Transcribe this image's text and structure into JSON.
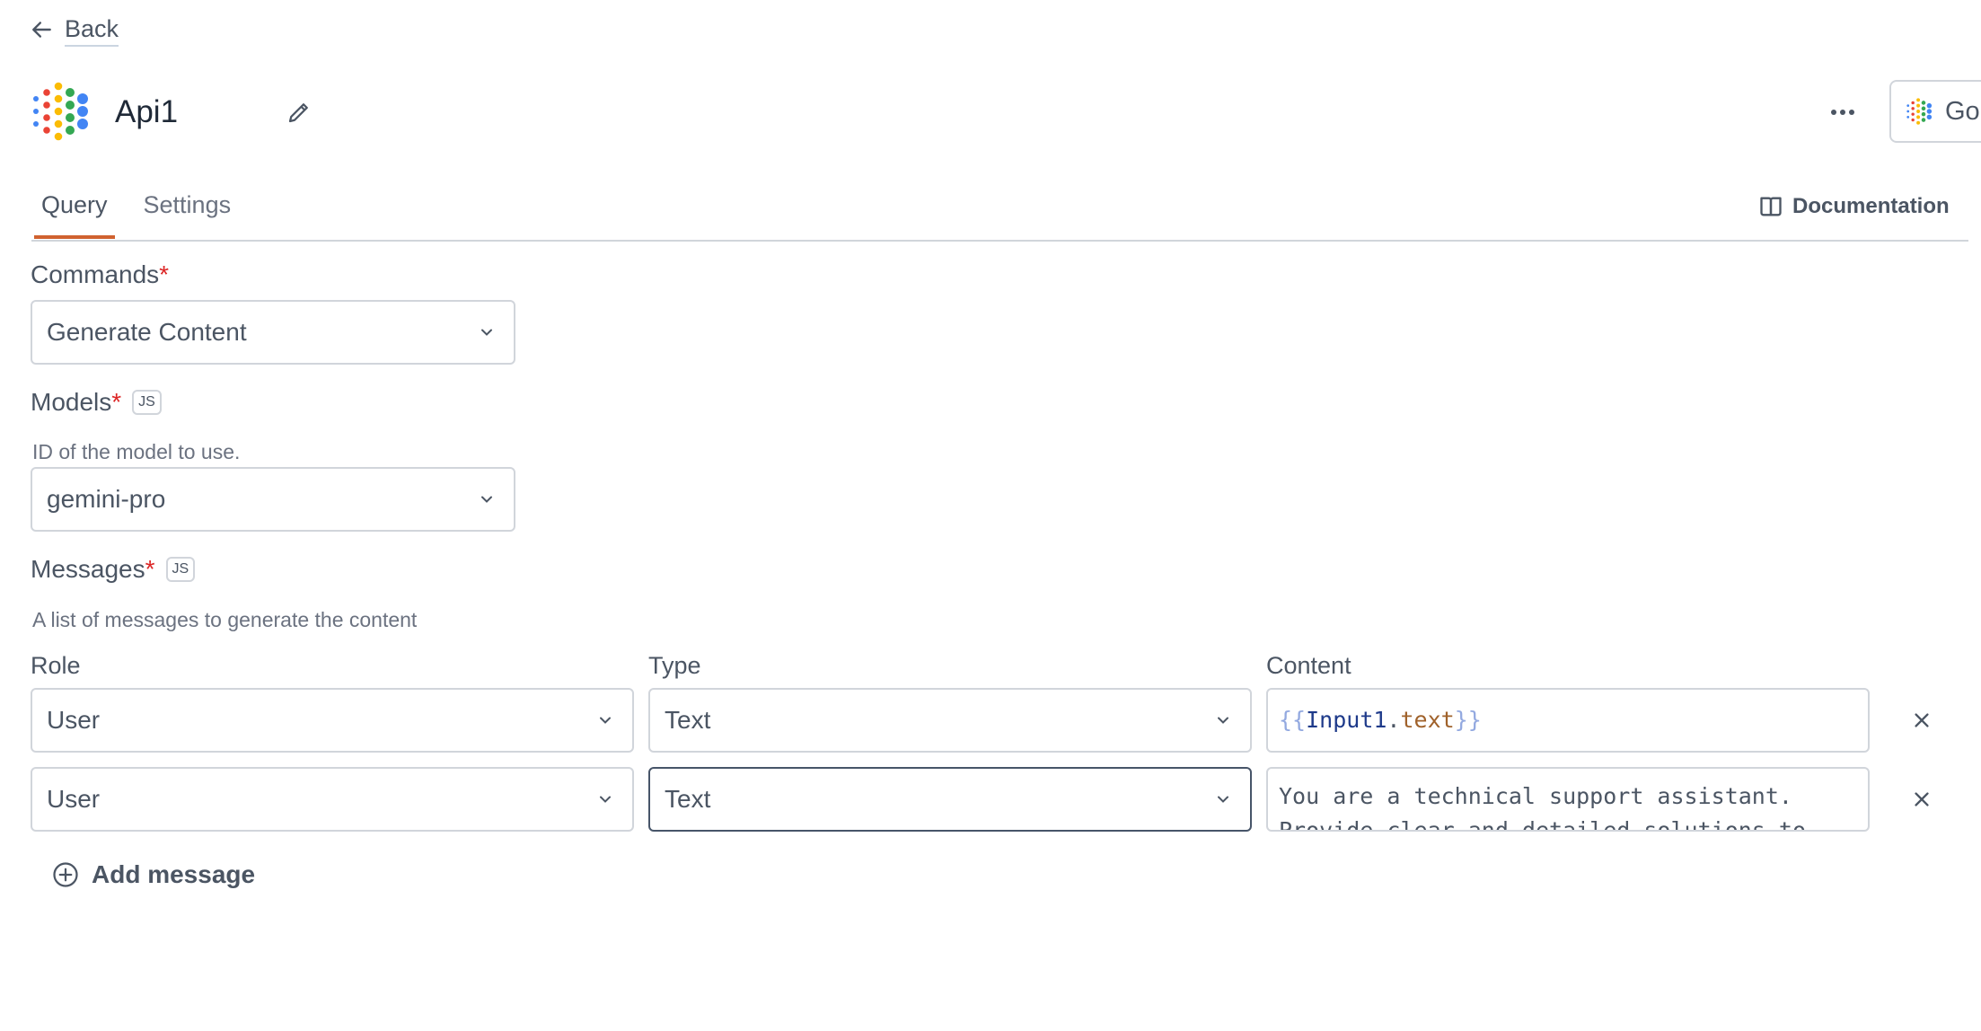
{
  "nav": {
    "back_label": "Back",
    "back_icon": "arrow-left-icon"
  },
  "header": {
    "title": "Api1",
    "logo_icon": "gemini-dots-logo",
    "edit_icon": "pencil-icon",
    "more_icon": "ellipsis-icon",
    "datasource_button_label": "Go"
  },
  "tabs": [
    {
      "label": "Query",
      "active": true
    },
    {
      "label": "Settings",
      "active": false
    }
  ],
  "documentation": {
    "label": "Documentation",
    "icon": "book-open-icon"
  },
  "form": {
    "commands": {
      "label": "Commands",
      "required": "*",
      "value": "Generate Content"
    },
    "models": {
      "label": "Models",
      "required": "*",
      "badge": "JS",
      "helper": "ID of the model to use.",
      "value": "gemini-pro"
    },
    "messages": {
      "label": "Messages",
      "required": "*",
      "badge": "JS",
      "helper": "A list of messages to generate the content",
      "columns": {
        "role": "Role",
        "type": "Type",
        "content": "Content"
      },
      "rows": [
        {
          "role": "User",
          "type": "Text",
          "content_parts": {
            "open": "{{",
            "ident": "Input1",
            "dot": ".",
            "prop": "text",
            "close": "}}"
          }
        },
        {
          "role": "User",
          "type": "Text",
          "content_lines": [
            "You are a technical support assistant.",
            "Provide clear and detailed solutions to"
          ]
        }
      ],
      "add_label": "Add message"
    }
  },
  "colors": {
    "accent_tab": "#d0622f",
    "required": "#dc2626",
    "border": "#d1d5db",
    "focused_border": "#475569"
  }
}
